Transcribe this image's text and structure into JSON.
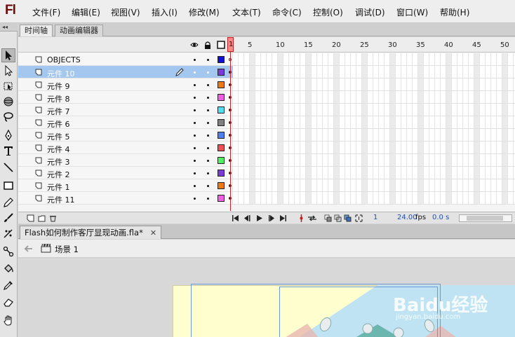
{
  "app": {
    "logo": "Fl"
  },
  "menu": [
    {
      "label": "文件(F)"
    },
    {
      "label": "编辑(E)"
    },
    {
      "label": "视图(V)"
    },
    {
      "label": "插入(I)"
    },
    {
      "label": "修改(M)"
    },
    {
      "label": "文本(T)"
    },
    {
      "label": "命令(C)"
    },
    {
      "label": "控制(O)"
    },
    {
      "label": "调试(D)"
    },
    {
      "label": "窗口(W)"
    },
    {
      "label": "帮助(H)"
    }
  ],
  "toolbar": {
    "grip": "◂◂"
  },
  "panel_tabs": {
    "timeline": "时间轴",
    "motion_editor": "动画编辑器"
  },
  "timeline": {
    "ruler": [
      "1",
      "5",
      "10",
      "15",
      "20",
      "25",
      "30",
      "35",
      "40",
      "45",
      "50"
    ],
    "current_frame": "1",
    "layers": [
      {
        "name": "OBJECTS",
        "color": null,
        "selected": false
      },
      {
        "name": "元件 10",
        "color": "#7a3ad8",
        "selected": true
      },
      {
        "name": "元件 9",
        "color": "#f07a10",
        "selected": false
      },
      {
        "name": "元件 8",
        "color": "#f060e0",
        "selected": false
      },
      {
        "name": "元件 7",
        "color": "#50e0f0",
        "selected": false
      },
      {
        "name": "元件 6",
        "color": "#808080",
        "selected": false
      },
      {
        "name": "元件 5",
        "color": "#5080f0",
        "selected": false
      },
      {
        "name": "元件 4",
        "color": "#f05050",
        "selected": false
      },
      {
        "name": "元件 3",
        "color": "#50f060",
        "selected": false
      },
      {
        "name": "元件 2",
        "color": "#7a3ad8",
        "selected": false
      },
      {
        "name": "元件 1",
        "color": "#f07a10",
        "selected": false
      },
      {
        "name": "元件 11",
        "color": "#f060e0",
        "selected": false
      }
    ],
    "objects_swatch": "#1010d0",
    "status": {
      "frame": "1",
      "fps": "24.00",
      "fps_unit": "fps",
      "time": "0.0 s"
    }
  },
  "document": {
    "tab_title": "Flash如何制作客厅显现动画.fla*",
    "close": "✕"
  },
  "editbar": {
    "scene": "场景 1"
  },
  "watermark": {
    "text": "Baidu经验",
    "sub": "jingyan.baidu.com"
  }
}
